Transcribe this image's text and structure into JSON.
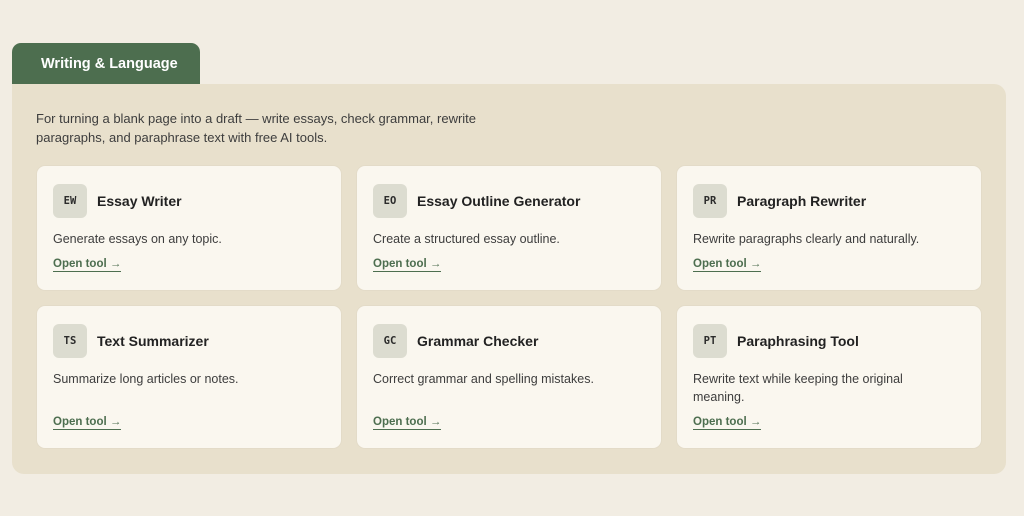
{
  "section": {
    "title": "Writing & Language",
    "description": "For turning a blank page into a draft — write essays, check grammar, rewrite paragraphs, and paraphrase text with free AI tools."
  },
  "cards": [
    {
      "badge": "EW",
      "title": "Essay Writer",
      "description": "Generate essays on any topic.",
      "link": "Open tool →"
    },
    {
      "badge": "EO",
      "title": "Essay Outline Generator",
      "description": "Create a structured essay outline.",
      "link": "Open tool →"
    },
    {
      "badge": "PR",
      "title": "Paragraph Rewriter",
      "description": "Rewrite paragraphs clearly and naturally.",
      "link": "Open tool →"
    },
    {
      "badge": "TS",
      "title": "Text Summarizer",
      "description": "Summarize long articles or notes.",
      "link": "Open tool →"
    },
    {
      "badge": "GC",
      "title": "Grammar Checker",
      "description": "Correct grammar and spelling mistakes.",
      "link": "Open tool →"
    },
    {
      "badge": "PT",
      "title": "Paraphrasing Tool",
      "description": "Rewrite text while keeping the original meaning.",
      "link": "Open tool →"
    }
  ],
  "colors": {
    "page_background": "#f2ede3",
    "panel_background": "#e8e0cc",
    "accent_green": "#4d6e4f",
    "card_background": "#faf7ef",
    "badge_background": "#dcdcd0"
  }
}
